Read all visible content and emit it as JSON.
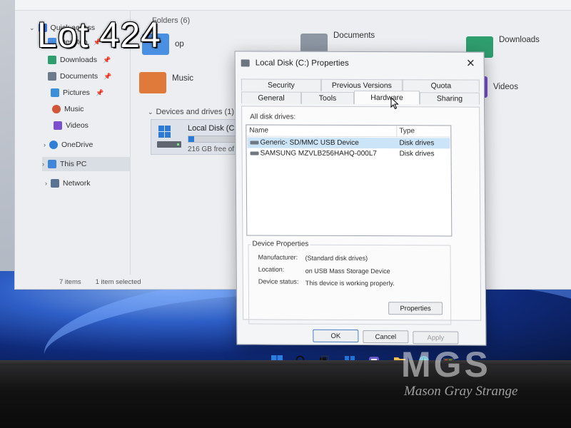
{
  "overlay": {
    "lot_label": "Lot 424",
    "watermark_logo": "MGS",
    "watermark_name": "Mason Gray Strange"
  },
  "explorer": {
    "nav": {
      "quick_access": "Quick access",
      "desktop": "Desktop",
      "downloads": "Downloads",
      "documents": "Documents",
      "pictures": "Pictures",
      "music": "Music",
      "videos": "Videos",
      "onedrive": "OneDrive",
      "this_pc": "This PC",
      "network": "Network"
    },
    "folders_header": "Folders (6)",
    "folders": {
      "desktop_partial": "op",
      "documents": "Documents",
      "downloads": "Downloads",
      "music": "Music",
      "videos": "Videos"
    },
    "drives_header": "Devices and drives (1)",
    "drive": {
      "name": "Local Disk (C:)",
      "free_text": "216 GB free of 237 G",
      "used_fraction": 0.09
    },
    "status": {
      "items": "7 items",
      "selected": "1 item selected"
    }
  },
  "dialog": {
    "title": "Local Disk (C:) Properties",
    "tabs_row1": [
      "Security",
      "Previous Versions",
      "Quota"
    ],
    "tabs_row2": [
      "General",
      "Tools",
      "Hardware",
      "Sharing"
    ],
    "active_tab": "Hardware",
    "all_disk_drives_label": "All disk drives:",
    "columns": {
      "name": "Name",
      "type": "Type"
    },
    "drives": [
      {
        "name": "Generic- SD/MMC USB Device",
        "type": "Disk drives",
        "selected": true
      },
      {
        "name": "SAMSUNG MZVLB256HAHQ-000L7",
        "type": "Disk drives",
        "selected": false
      }
    ],
    "device_properties": {
      "title": "Device Properties",
      "manufacturer_label": "Manufacturer:",
      "manufacturer_value": "(Standard disk drives)",
      "location_label": "Location:",
      "location_value": "on USB Mass Storage Device",
      "status_label": "Device status:",
      "status_value": "This device is working properly."
    },
    "buttons": {
      "properties": "Properties",
      "ok": "OK",
      "cancel": "Cancel",
      "apply": "Apply"
    }
  },
  "colors": {
    "accent": "#2a7ad6",
    "selection": "#cce4f7",
    "wallpaper_blue": "#2e5fc7"
  },
  "taskbar": {
    "icons": [
      "windows-start-icon",
      "search-icon",
      "task-view-icon",
      "widgets-icon",
      "teams-chat-icon",
      "file-explorer-icon",
      "edge-icon",
      "store-icon"
    ]
  }
}
